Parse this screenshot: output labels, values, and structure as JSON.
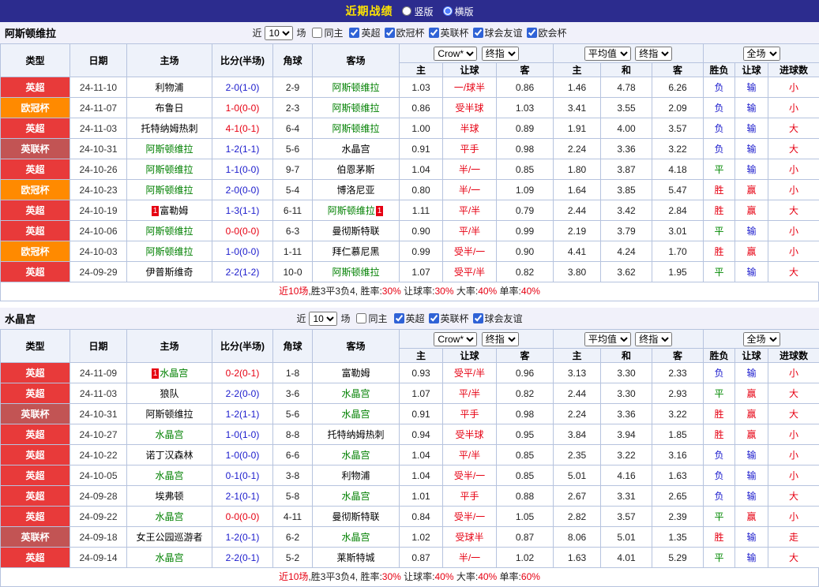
{
  "palette": {
    "topbar_bg": "#2c2c8e",
    "title_color": "#ffe400",
    "band_bg": "#f1f1fa",
    "head_bg": "#eef2fa",
    "border": "#b6c3de",
    "red": "#e60012",
    "blue": "#1a1acc",
    "green": "#008800",
    "black": "#222222",
    "focus_green": "#008000"
  },
  "league_colors": {
    "英超": "#e83a3a",
    "欧冠杯": "#ff8a00",
    "英联杯": "#c25454"
  },
  "top_bar": {
    "title": "近期战绩",
    "radios": [
      {
        "label": "竖版",
        "checked": false
      },
      {
        "label": "横版",
        "checked": true
      }
    ]
  },
  "sections": [
    {
      "team": "阿斯顿维拉",
      "filter": {
        "near_label": "近",
        "count": "10",
        "games_label": "场",
        "same_host": {
          "label": "同主",
          "checked": false
        },
        "leagues": [
          {
            "label": "英超",
            "checked": true
          },
          {
            "label": "欧冠杯",
            "checked": true
          },
          {
            "label": "英联杯",
            "checked": true
          },
          {
            "label": "球会友谊",
            "checked": true
          },
          {
            "label": "欧会杯",
            "checked": true
          }
        ]
      },
      "header": {
        "selects": {
          "book": "Crow*",
          "book_index": "终指",
          "avg": "平均值",
          "avg_index": "终指",
          "scope": "全场"
        },
        "cols": {
          "type": "类型",
          "date": "日期",
          "home": "主场",
          "score": "比分(半场)",
          "corner": "角球",
          "away": "客场",
          "h": "主",
          "handicap": "让球",
          "a": "客",
          "avg_h": "主",
          "avg_d": "和",
          "avg_a": "客",
          "wdl": "胜负",
          "hres": "让球",
          "goals": "进球数"
        }
      },
      "rows": [
        {
          "lg": "英超",
          "date": "24-11-10",
          "home": {
            "n": "利物浦",
            "f": false
          },
          "score": "2-0(1-0)",
          "sc": "blue",
          "corner": "2-9",
          "away": {
            "n": "阿斯顿维拉",
            "f": true
          },
          "odds": [
            "1.03",
            "一/球半",
            "0.86"
          ],
          "avg": [
            "1.46",
            "4.78",
            "6.26"
          ],
          "res": [
            [
              "负",
              "blue"
            ],
            [
              "输",
              "blue"
            ],
            [
              "小",
              "red"
            ]
          ]
        },
        {
          "lg": "欧冠杯",
          "date": "24-11-07",
          "home": {
            "n": "布鲁日",
            "f": false
          },
          "score": "1-0(0-0)",
          "sc": "red",
          "corner": "2-3",
          "away": {
            "n": "阿斯顿维拉",
            "f": true
          },
          "odds": [
            "0.86",
            "受半球",
            "1.03"
          ],
          "avg": [
            "3.41",
            "3.55",
            "2.09"
          ],
          "res": [
            [
              "负",
              "blue"
            ],
            [
              "输",
              "blue"
            ],
            [
              "小",
              "red"
            ]
          ]
        },
        {
          "lg": "英超",
          "date": "24-11-03",
          "home": {
            "n": "托特纳姆热刺",
            "f": false
          },
          "score": "4-1(0-1)",
          "sc": "red",
          "corner": "6-4",
          "away": {
            "n": "阿斯顿维拉",
            "f": true
          },
          "odds": [
            "1.00",
            "半球",
            "0.89"
          ],
          "avg": [
            "1.91",
            "4.00",
            "3.57"
          ],
          "res": [
            [
              "负",
              "blue"
            ],
            [
              "输",
              "blue"
            ],
            [
              "大",
              "red"
            ]
          ]
        },
        {
          "lg": "英联杯",
          "date": "24-10-31",
          "home": {
            "n": "阿斯顿维拉",
            "f": true
          },
          "score": "1-2(1-1)",
          "sc": "blue",
          "corner": "5-6",
          "away": {
            "n": "水晶宫",
            "f": false
          },
          "odds": [
            "0.91",
            "平手",
            "0.98"
          ],
          "avg": [
            "2.24",
            "3.36",
            "3.22"
          ],
          "res": [
            [
              "负",
              "blue"
            ],
            [
              "输",
              "blue"
            ],
            [
              "大",
              "red"
            ]
          ]
        },
        {
          "lg": "英超",
          "date": "24-10-26",
          "home": {
            "n": "阿斯顿维拉",
            "f": true
          },
          "score": "1-1(0-0)",
          "sc": "blue",
          "corner": "9-7",
          "away": {
            "n": "伯恩茅斯",
            "f": false
          },
          "odds": [
            "1.04",
            "半/一",
            "0.85"
          ],
          "avg": [
            "1.80",
            "3.87",
            "4.18"
          ],
          "res": [
            [
              "平",
              "green"
            ],
            [
              "输",
              "blue"
            ],
            [
              "小",
              "red"
            ]
          ]
        },
        {
          "lg": "欧冠杯",
          "date": "24-10-23",
          "home": {
            "n": "阿斯顿维拉",
            "f": true
          },
          "score": "2-0(0-0)",
          "sc": "blue",
          "corner": "5-4",
          "away": {
            "n": "博洛尼亚",
            "f": false
          },
          "odds": [
            "0.80",
            "半/一",
            "1.09"
          ],
          "avg": [
            "1.64",
            "3.85",
            "5.47"
          ],
          "res": [
            [
              "胜",
              "red"
            ],
            [
              "赢",
              "red"
            ],
            [
              "小",
              "red"
            ]
          ]
        },
        {
          "lg": "英超",
          "date": "24-10-19",
          "home": {
            "n": "富勒姆",
            "f": false,
            "pre": "1"
          },
          "score": "1-3(1-1)",
          "sc": "blue",
          "corner": "6-11",
          "away": {
            "n": "阿斯顿维拉",
            "f": true,
            "post": "1"
          },
          "odds": [
            "1.11",
            "平/半",
            "0.79"
          ],
          "avg": [
            "2.44",
            "3.42",
            "2.84"
          ],
          "res": [
            [
              "胜",
              "red"
            ],
            [
              "赢",
              "red"
            ],
            [
              "大",
              "red"
            ]
          ]
        },
        {
          "lg": "英超",
          "date": "24-10-06",
          "home": {
            "n": "阿斯顿维拉",
            "f": true
          },
          "score": "0-0(0-0)",
          "sc": "red",
          "corner": "6-3",
          "away": {
            "n": "曼彻斯特联",
            "f": false
          },
          "odds": [
            "0.90",
            "平/半",
            "0.99"
          ],
          "avg": [
            "2.19",
            "3.79",
            "3.01"
          ],
          "res": [
            [
              "平",
              "green"
            ],
            [
              "输",
              "blue"
            ],
            [
              "小",
              "red"
            ]
          ]
        },
        {
          "lg": "欧冠杯",
          "date": "24-10-03",
          "home": {
            "n": "阿斯顿维拉",
            "f": true
          },
          "score": "1-0(0-0)",
          "sc": "blue",
          "corner": "1-11",
          "away": {
            "n": "拜仁慕尼黑",
            "f": false
          },
          "odds": [
            "0.99",
            "受半/一",
            "0.90"
          ],
          "avg": [
            "4.41",
            "4.24",
            "1.70"
          ],
          "res": [
            [
              "胜",
              "red"
            ],
            [
              "赢",
              "red"
            ],
            [
              "小",
              "red"
            ]
          ]
        },
        {
          "lg": "英超",
          "date": "24-09-29",
          "home": {
            "n": "伊普斯维奇",
            "f": false
          },
          "score": "2-2(1-2)",
          "sc": "blue",
          "corner": "10-0",
          "away": {
            "n": "阿斯顿维拉",
            "f": true
          },
          "odds": [
            "1.07",
            "受平/半",
            "0.82"
          ],
          "avg": [
            "3.80",
            "3.62",
            "1.95"
          ],
          "res": [
            [
              "平",
              "green"
            ],
            [
              "输",
              "blue"
            ],
            [
              "大",
              "red"
            ]
          ]
        }
      ],
      "summary": [
        {
          "t": "近10场",
          "c": "red"
        },
        {
          "t": ",胜3平3负4, 胜率:",
          "c": "black"
        },
        {
          "t": "30%",
          "c": "red"
        },
        {
          "t": " 让球率:",
          "c": "black"
        },
        {
          "t": "30%",
          "c": "red"
        },
        {
          "t": " 大率:",
          "c": "black"
        },
        {
          "t": "40%",
          "c": "red"
        },
        {
          "t": " 单率:",
          "c": "black"
        },
        {
          "t": "40%",
          "c": "red"
        }
      ]
    },
    {
      "team": "水晶宫",
      "filter": {
        "near_label": "近",
        "count": "10",
        "games_label": "场",
        "same_host": {
          "label": "同主",
          "checked": false
        },
        "leagues": [
          {
            "label": "英超",
            "checked": true
          },
          {
            "label": "英联杯",
            "checked": true
          },
          {
            "label": "球会友谊",
            "checked": true
          }
        ]
      },
      "header": {
        "selects": {
          "book": "Crow*",
          "book_index": "终指",
          "avg": "平均值",
          "avg_index": "终指",
          "scope": "全场"
        },
        "cols": {
          "type": "类型",
          "date": "日期",
          "home": "主场",
          "score": "比分(半场)",
          "corner": "角球",
          "away": "客场",
          "h": "主",
          "handicap": "让球",
          "a": "客",
          "avg_h": "主",
          "avg_d": "和",
          "avg_a": "客",
          "wdl": "胜负",
          "hres": "让球",
          "goals": "进球数"
        }
      },
      "rows": [
        {
          "lg": "英超",
          "date": "24-11-09",
          "home": {
            "n": "水晶宫",
            "f": true,
            "pre": "1"
          },
          "score": "0-2(0-1)",
          "sc": "red",
          "corner": "1-8",
          "away": {
            "n": "富勒姆",
            "f": false
          },
          "odds": [
            "0.93",
            "受平/半",
            "0.96"
          ],
          "avg": [
            "3.13",
            "3.30",
            "2.33"
          ],
          "res": [
            [
              "负",
              "blue"
            ],
            [
              "输",
              "blue"
            ],
            [
              "小",
              "red"
            ]
          ]
        },
        {
          "lg": "英超",
          "date": "24-11-03",
          "home": {
            "n": "狼队",
            "f": false
          },
          "score": "2-2(0-0)",
          "sc": "blue",
          "corner": "3-6",
          "away": {
            "n": "水晶宫",
            "f": true
          },
          "odds": [
            "1.07",
            "平/半",
            "0.82"
          ],
          "avg": [
            "2.44",
            "3.30",
            "2.93"
          ],
          "res": [
            [
              "平",
              "green"
            ],
            [
              "赢",
              "red"
            ],
            [
              "大",
              "red"
            ]
          ]
        },
        {
          "lg": "英联杯",
          "date": "24-10-31",
          "home": {
            "n": "阿斯顿维拉",
            "f": false
          },
          "score": "1-2(1-1)",
          "sc": "blue",
          "corner": "5-6",
          "away": {
            "n": "水晶宫",
            "f": true
          },
          "odds": [
            "0.91",
            "平手",
            "0.98"
          ],
          "avg": [
            "2.24",
            "3.36",
            "3.22"
          ],
          "res": [
            [
              "胜",
              "red"
            ],
            [
              "赢",
              "red"
            ],
            [
              "大",
              "red"
            ]
          ]
        },
        {
          "lg": "英超",
          "date": "24-10-27",
          "home": {
            "n": "水晶宫",
            "f": true
          },
          "score": "1-0(1-0)",
          "sc": "blue",
          "corner": "8-8",
          "away": {
            "n": "托特纳姆热刺",
            "f": false
          },
          "odds": [
            "0.94",
            "受半球",
            "0.95"
          ],
          "avg": [
            "3.84",
            "3.94",
            "1.85"
          ],
          "res": [
            [
              "胜",
              "red"
            ],
            [
              "赢",
              "red"
            ],
            [
              "小",
              "red"
            ]
          ]
        },
        {
          "lg": "英超",
          "date": "24-10-22",
          "home": {
            "n": "诺丁汉森林",
            "f": false
          },
          "score": "1-0(0-0)",
          "sc": "blue",
          "corner": "6-6",
          "away": {
            "n": "水晶宫",
            "f": true
          },
          "odds": [
            "1.04",
            "平/半",
            "0.85"
          ],
          "avg": [
            "2.35",
            "3.22",
            "3.16"
          ],
          "res": [
            [
              "负",
              "blue"
            ],
            [
              "输",
              "blue"
            ],
            [
              "小",
              "red"
            ]
          ]
        },
        {
          "lg": "英超",
          "date": "24-10-05",
          "home": {
            "n": "水晶宫",
            "f": true
          },
          "score": "0-1(0-1)",
          "sc": "blue",
          "corner": "3-8",
          "away": {
            "n": "利物浦",
            "f": false
          },
          "odds": [
            "1.04",
            "受半/一",
            "0.85"
          ],
          "avg": [
            "5.01",
            "4.16",
            "1.63"
          ],
          "res": [
            [
              "负",
              "blue"
            ],
            [
              "输",
              "blue"
            ],
            [
              "小",
              "red"
            ]
          ]
        },
        {
          "lg": "英超",
          "date": "24-09-28",
          "home": {
            "n": "埃弗顿",
            "f": false
          },
          "score": "2-1(0-1)",
          "sc": "blue",
          "corner": "5-8",
          "away": {
            "n": "水晶宫",
            "f": true
          },
          "odds": [
            "1.01",
            "平手",
            "0.88"
          ],
          "avg": [
            "2.67",
            "3.31",
            "2.65"
          ],
          "res": [
            [
              "负",
              "blue"
            ],
            [
              "输",
              "blue"
            ],
            [
              "大",
              "red"
            ]
          ]
        },
        {
          "lg": "英超",
          "date": "24-09-22",
          "home": {
            "n": "水晶宫",
            "f": true
          },
          "score": "0-0(0-0)",
          "sc": "red",
          "corner": "4-11",
          "away": {
            "n": "曼彻斯特联",
            "f": false
          },
          "odds": [
            "0.84",
            "受半/一",
            "1.05"
          ],
          "avg": [
            "2.82",
            "3.57",
            "2.39"
          ],
          "res": [
            [
              "平",
              "green"
            ],
            [
              "赢",
              "red"
            ],
            [
              "小",
              "red"
            ]
          ]
        },
        {
          "lg": "英联杯",
          "date": "24-09-18",
          "home": {
            "n": "女王公园巡游者",
            "f": false
          },
          "score": "1-2(0-1)",
          "sc": "blue",
          "corner": "6-2",
          "away": {
            "n": "水晶宫",
            "f": true
          },
          "odds": [
            "1.02",
            "受球半",
            "0.87"
          ],
          "avg": [
            "8.06",
            "5.01",
            "1.35"
          ],
          "res": [
            [
              "胜",
              "red"
            ],
            [
              "输",
              "blue"
            ],
            [
              "走",
              "red"
            ]
          ]
        },
        {
          "lg": "英超",
          "date": "24-09-14",
          "home": {
            "n": "水晶宫",
            "f": true
          },
          "score": "2-2(0-1)",
          "sc": "blue",
          "corner": "5-2",
          "away": {
            "n": "莱斯特城",
            "f": false
          },
          "odds": [
            "0.87",
            "半/一",
            "1.02"
          ],
          "avg": [
            "1.63",
            "4.01",
            "5.29"
          ],
          "res": [
            [
              "平",
              "green"
            ],
            [
              "输",
              "blue"
            ],
            [
              "大",
              "red"
            ]
          ]
        }
      ],
      "summary": [
        {
          "t": "近10场",
          "c": "red"
        },
        {
          "t": ",胜3平3负4, 胜率:",
          "c": "black"
        },
        {
          "t": "30%",
          "c": "red"
        },
        {
          "t": " 让球率:",
          "c": "black"
        },
        {
          "t": "40%",
          "c": "red"
        },
        {
          "t": " 大率:",
          "c": "black"
        },
        {
          "t": "40%",
          "c": "red"
        },
        {
          "t": " 单率:",
          "c": "black"
        },
        {
          "t": "60%",
          "c": "red"
        }
      ]
    }
  ]
}
